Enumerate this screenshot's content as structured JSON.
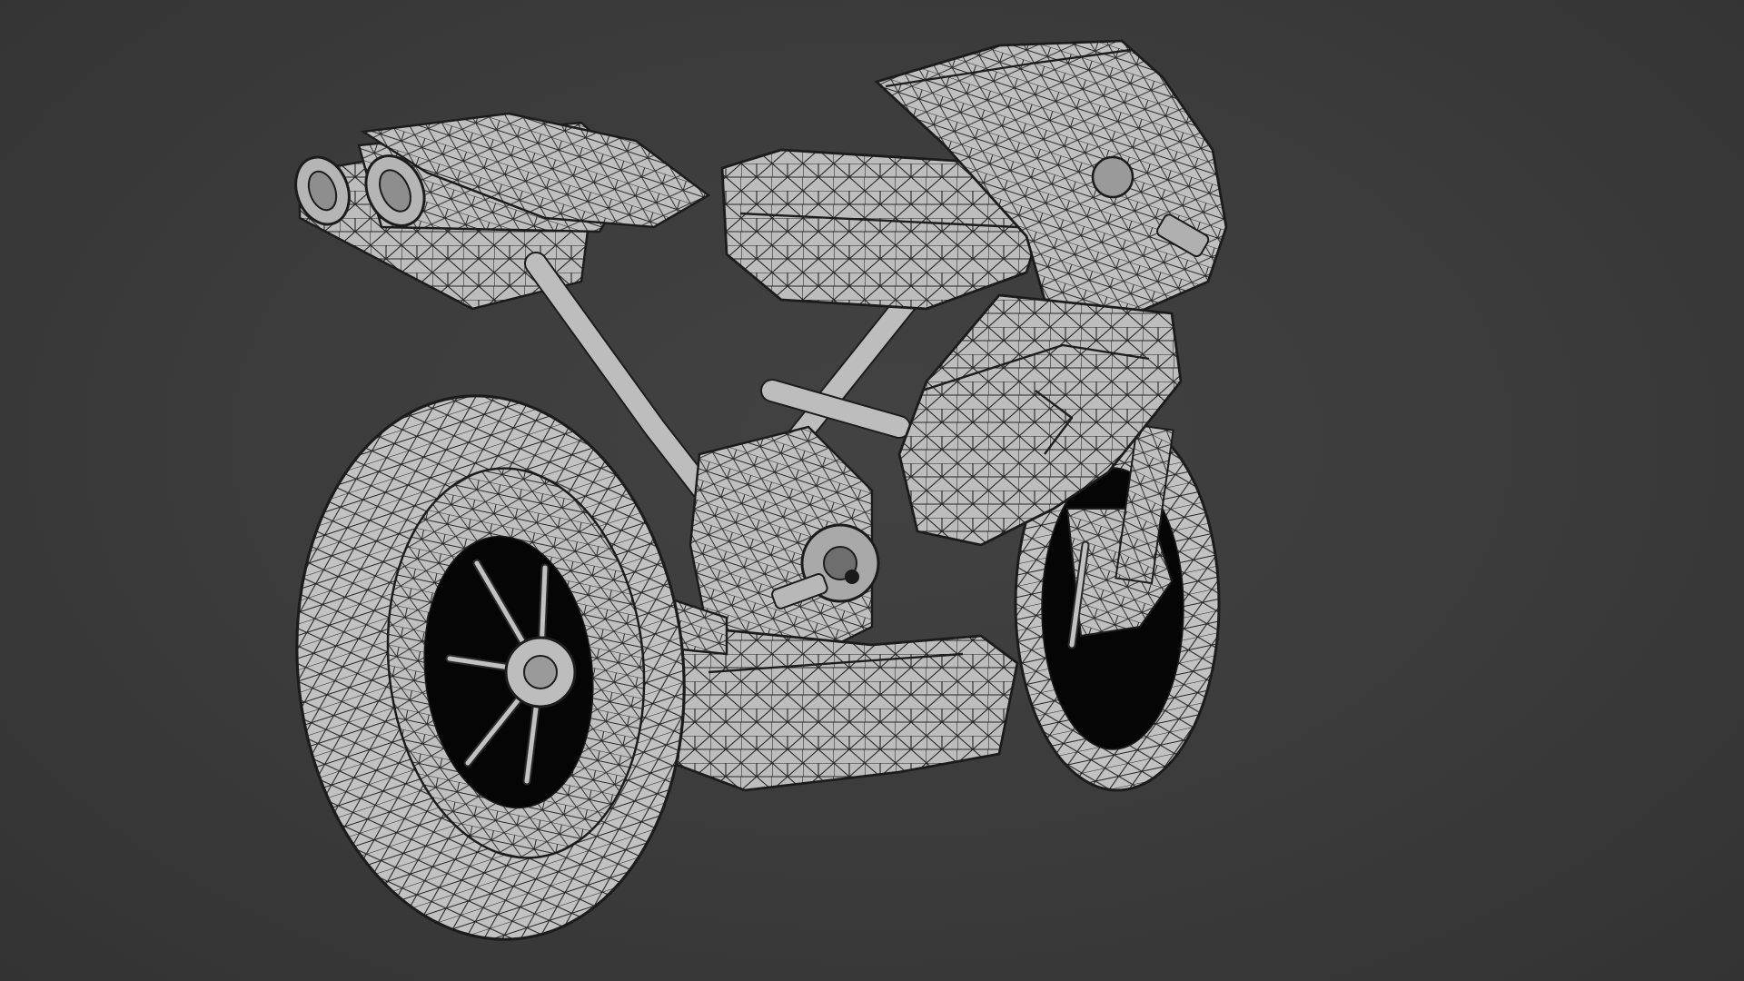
{
  "viewport": {
    "background": "#3a3a3a",
    "mesh_color": "#bdbdbd",
    "wire_color": "#1c1c1c",
    "display_mode": "wireframe-overlay"
  },
  "object": {
    "type": "motorcycle",
    "parts": [
      "rear-wheel",
      "front-wheel",
      "exhaust-pipes",
      "fuel-tank",
      "fairing",
      "windscreen",
      "frame",
      "swingarm",
      "engine",
      "belly-pan",
      "seat-tail"
    ]
  }
}
